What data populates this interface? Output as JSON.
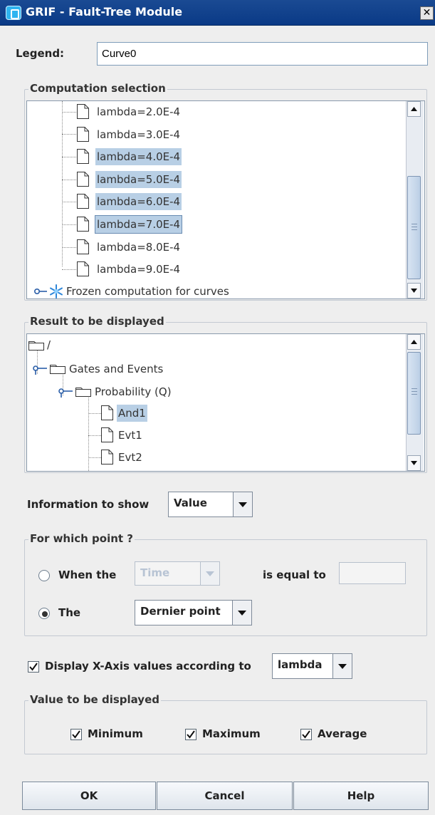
{
  "window": {
    "title": "GRIF - Fault-Tree Module",
    "close_glyph": "✕"
  },
  "legend": {
    "label": "Legend:",
    "value": "Curve0"
  },
  "computation": {
    "title": "Computation selection",
    "items": [
      {
        "label": "lambda=2.0E-4",
        "selected": false
      },
      {
        "label": "lambda=3.0E-4",
        "selected": false
      },
      {
        "label": "lambda=4.0E-4",
        "selected": true
      },
      {
        "label": "lambda=5.0E-4",
        "selected": true
      },
      {
        "label": "lambda=6.0E-4",
        "selected": true
      },
      {
        "label": "lambda=7.0E-4",
        "selected": true
      },
      {
        "label": "lambda=8.0E-4",
        "selected": false
      },
      {
        "label": "lambda=9.0E-4",
        "selected": false
      }
    ],
    "frozen_label": "Frozen computation for curves"
  },
  "result": {
    "title": "Result to be displayed",
    "root": "/",
    "gates": "Gates and Events",
    "probability": "Probability (Q)",
    "leaves": [
      "And1",
      "Evt1",
      "Evt2"
    ],
    "selected_leaf": "And1"
  },
  "info": {
    "label": "Information to show",
    "value": "Value"
  },
  "point": {
    "title": "For which point ?",
    "when_label": "When the",
    "when_combo": "Time",
    "equal_label": "is equal to",
    "equal_value": "",
    "the_label": "The",
    "the_combo": "Dernier point",
    "selected_option": "The"
  },
  "xaxis": {
    "label": "Display X-Axis values according to",
    "value": "lambda",
    "checked": true
  },
  "value_group": {
    "title": "Value to be displayed",
    "minimum": "Minimum",
    "maximum": "Maximum",
    "average": "Average",
    "minimum_checked": true,
    "maximum_checked": true,
    "average_checked": true
  },
  "buttons": {
    "ok": "OK",
    "cancel": "Cancel",
    "help": "Help"
  }
}
